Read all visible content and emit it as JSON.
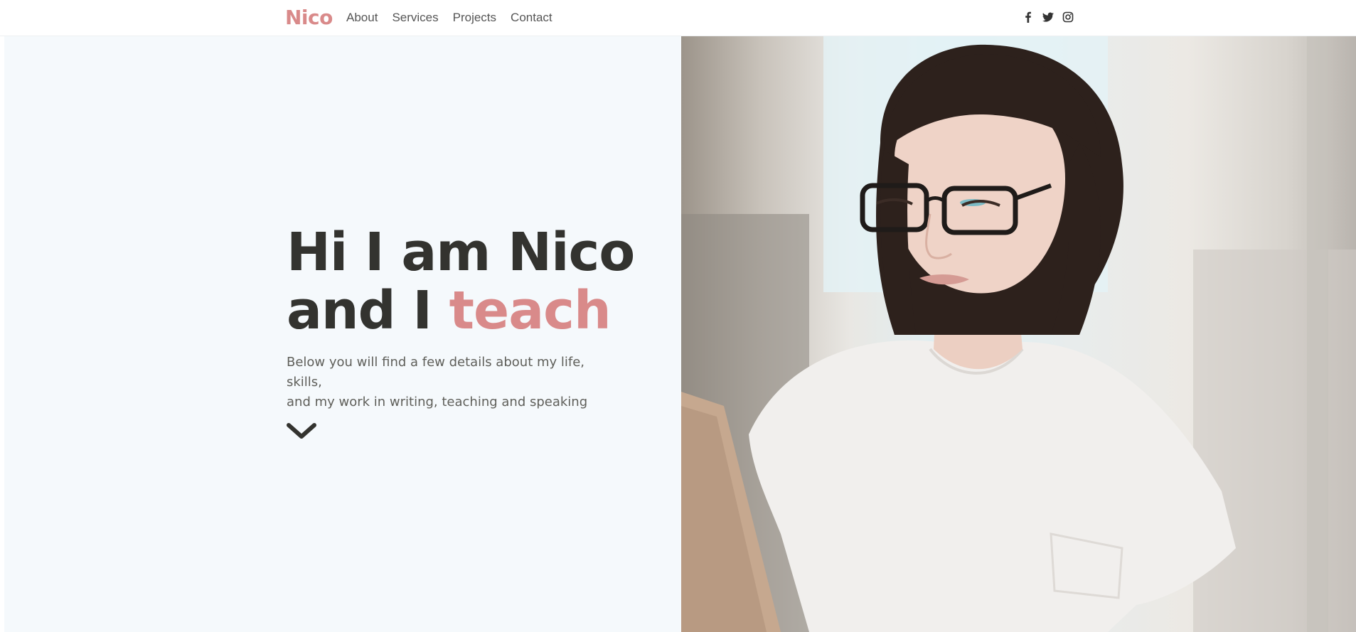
{
  "nav": {
    "brand": "Nico",
    "links": [
      "About",
      "Services",
      "Projects",
      "Contact"
    ],
    "social_icons": [
      "facebook-icon",
      "twitter-icon",
      "instagram-icon"
    ]
  },
  "hero": {
    "headline_line1": "Hi I am Nico",
    "headline_line2_prefix": "and I ",
    "headline_accent": "teach",
    "subtext_line1": "Below you will find a few details about my life, skills,",
    "subtext_line2": "and my work in writing, teaching and speaking",
    "scroll_icon": "chevron-down-icon",
    "photo_alt": "Woman with glasses working on a laptop"
  },
  "colors": {
    "accent": "#d98a8a",
    "heading": "#33332f",
    "body_text": "#5f5f5a",
    "hero_background": "#f5f9fc",
    "navbar_background": "#ffffff"
  }
}
